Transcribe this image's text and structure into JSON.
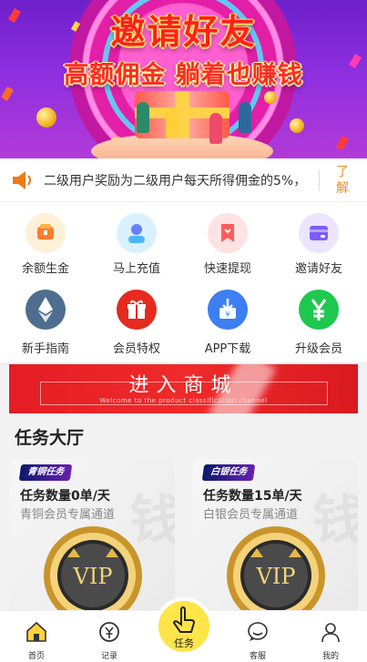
{
  "banner": {
    "title": "邀请好友",
    "subtitle": "高额佣金 躺着也赚钱"
  },
  "notice": {
    "text": "二级用户奖励为二级用户每天所得佣金的5%，",
    "more_label": "了解",
    "icon": "speaker-icon"
  },
  "grid": {
    "items": [
      {
        "label": "余额生金",
        "icon": "wallet-icon",
        "color": "#ff7b2e"
      },
      {
        "label": "马上充值",
        "icon": "user-recharge-icon",
        "color": "#6a7fff"
      },
      {
        "label": "快速提现",
        "icon": "bookmark-icon",
        "color": "#ff5b5b"
      },
      {
        "label": "邀请好友",
        "icon": "wallet-card-icon",
        "color": "#7a5cff"
      },
      {
        "label": "新手指南",
        "icon": "ethereum-icon",
        "color": "#4f6d8f"
      },
      {
        "label": "会员特权",
        "icon": "gift-icon",
        "color": "#e52a1f"
      },
      {
        "label": "APP下载",
        "icon": "download-icon",
        "color": "#3d7ef2"
      },
      {
        "label": "升级会员",
        "icon": "yen-icon",
        "color": "#1ec84e"
      }
    ]
  },
  "shop": {
    "title": "进入商城",
    "subtitle": "Welcome to the product classification channel"
  },
  "hall": {
    "title": "任务大厅",
    "cards": [
      {
        "badge": "青铜任务",
        "count": "任务数量0单/天",
        "desc": "青铜会员专属通道"
      },
      {
        "badge": "白银任务",
        "count": "任务数量15单/天",
        "desc": "白银会员专属通道"
      }
    ],
    "vip_label": "VIP"
  },
  "tabbar": {
    "items": [
      {
        "label": "首页",
        "icon": "home-icon"
      },
      {
        "label": "记录",
        "icon": "record-icon"
      },
      {
        "label": "任务",
        "icon": "tap-icon"
      },
      {
        "label": "客服",
        "icon": "chat-icon"
      },
      {
        "label": "我的",
        "icon": "user-icon"
      }
    ]
  }
}
